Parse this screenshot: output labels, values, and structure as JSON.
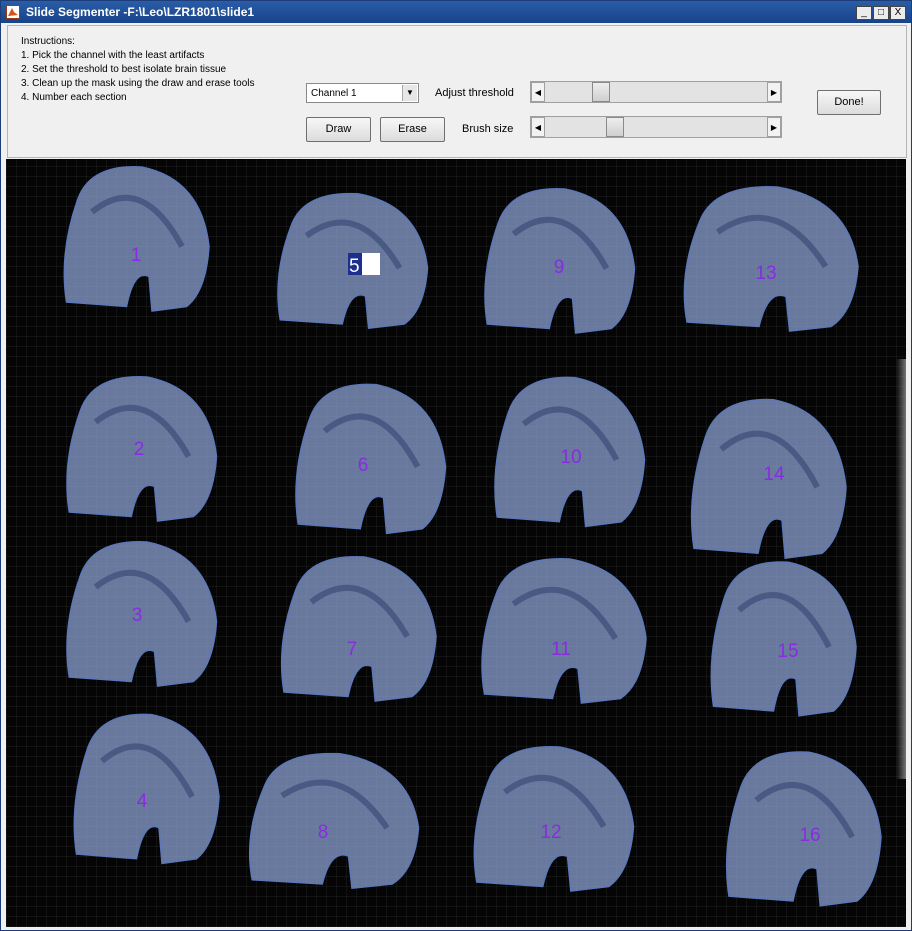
{
  "window": {
    "title": "Slide Segmenter -F:\\Leo\\LZR1801\\slide1",
    "minimize": "_",
    "maximize": "□",
    "close": "X"
  },
  "instructions": {
    "heading": "Instructions:",
    "steps": [
      "1. Pick the channel with the least artifacts",
      "2. Set the threshold to best isolate brain tissue",
      "3. Clean up the mask using the draw and erase tools",
      "4. Number each section"
    ]
  },
  "controls": {
    "channel_selected": "Channel 1",
    "draw_label": "Draw",
    "erase_label": "Erase",
    "threshold_label": "Adjust threshold",
    "brush_label": "Brush size",
    "done_label": "Done!",
    "threshold_value": 0.23,
    "brush_value": 0.3
  },
  "image": {
    "mask_color": "#8fa6d8",
    "number_color": "#8a2be2",
    "active_input_value": "5",
    "sections": [
      {
        "label": "1"
      },
      {
        "label": "2"
      },
      {
        "label": "3"
      },
      {
        "label": "4"
      },
      {
        "label": "5"
      },
      {
        "label": "6"
      },
      {
        "label": "7"
      },
      {
        "label": "8"
      },
      {
        "label": "9"
      },
      {
        "label": "10"
      },
      {
        "label": "11"
      },
      {
        "label": "12"
      },
      {
        "label": "13"
      },
      {
        "label": "14"
      },
      {
        "label": "15"
      },
      {
        "label": "16"
      }
    ]
  }
}
